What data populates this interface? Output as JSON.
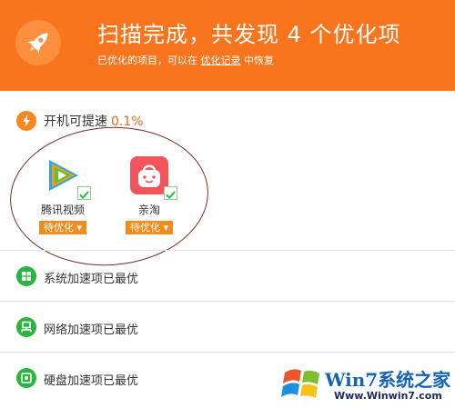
{
  "header": {
    "title": "扫描完成，共发现 4 个优化项",
    "subtitle_prefix": "已优化的项目，可以在",
    "subtitle_link": "优化记录",
    "subtitle_suffix": "中恢复",
    "bg_color": "#f8741d",
    "icon": "rocket-icon"
  },
  "boot": {
    "label": "开机可提速",
    "value": "0.1%",
    "icon": "lightning-icon",
    "value_color": "#f06a1a"
  },
  "apps": [
    {
      "name": "腾讯视频",
      "button": "待优化",
      "icon": "tencent-video-icon",
      "checked": true
    },
    {
      "name": "亲淘",
      "button": "待优化",
      "icon": "qintao-bag-icon",
      "checked": true
    }
  ],
  "rows": [
    {
      "label": "系统加速项已最优",
      "icon": "windows-icon"
    },
    {
      "label": "网络加速项已最优",
      "icon": "network-icon"
    },
    {
      "label": "硬盘加速项已最优",
      "icon": "disk-icon"
    }
  ],
  "watermark": {
    "brand": "Win7系统之家",
    "url": "Www.Winwin7.com"
  },
  "colors": {
    "accent_orange": "#f08c1c",
    "ok_green": "#2bb43f"
  }
}
